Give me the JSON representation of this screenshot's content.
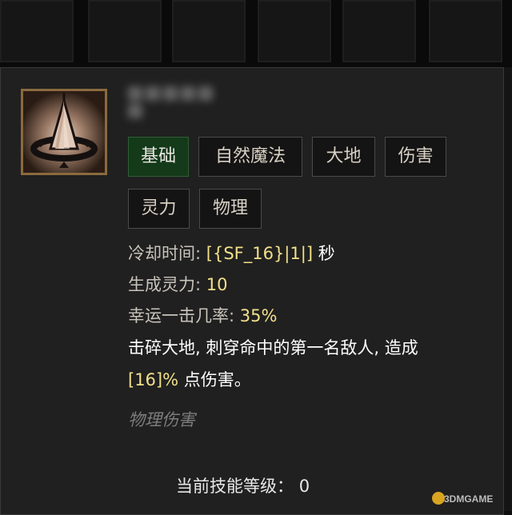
{
  "skill": {
    "name": "",
    "tags": [
      "基础",
      "自然魔法",
      "大地",
      "伤害",
      "灵力",
      "物理"
    ],
    "active_tag": "基础",
    "cooldown_label": "冷却时间:",
    "cooldown_value": "[{SF_16}|1|]",
    "cooldown_unit": "秒",
    "spirit_label": "生成灵力:",
    "spirit_value": "10",
    "lucky_label": "幸运一击几率:",
    "lucky_value": "35%",
    "description_line1": "击碎大地, 刺穿命中的第一名敌人, 造成",
    "description_value": "[16]%",
    "description_line2": "点伤害。",
    "flavor": "物理伤害",
    "current_level_label": "当前技能等级：",
    "current_level_value": "0"
  },
  "watermark": {
    "text": "3DMGAME"
  },
  "icons": {
    "skill": "earth-spike-icon"
  },
  "colors": {
    "panel_bg": "#202020",
    "tag_active_bg": "#143a1a",
    "value_highlight": "#f2e08a",
    "icon_frame": "#8b6a3e"
  }
}
